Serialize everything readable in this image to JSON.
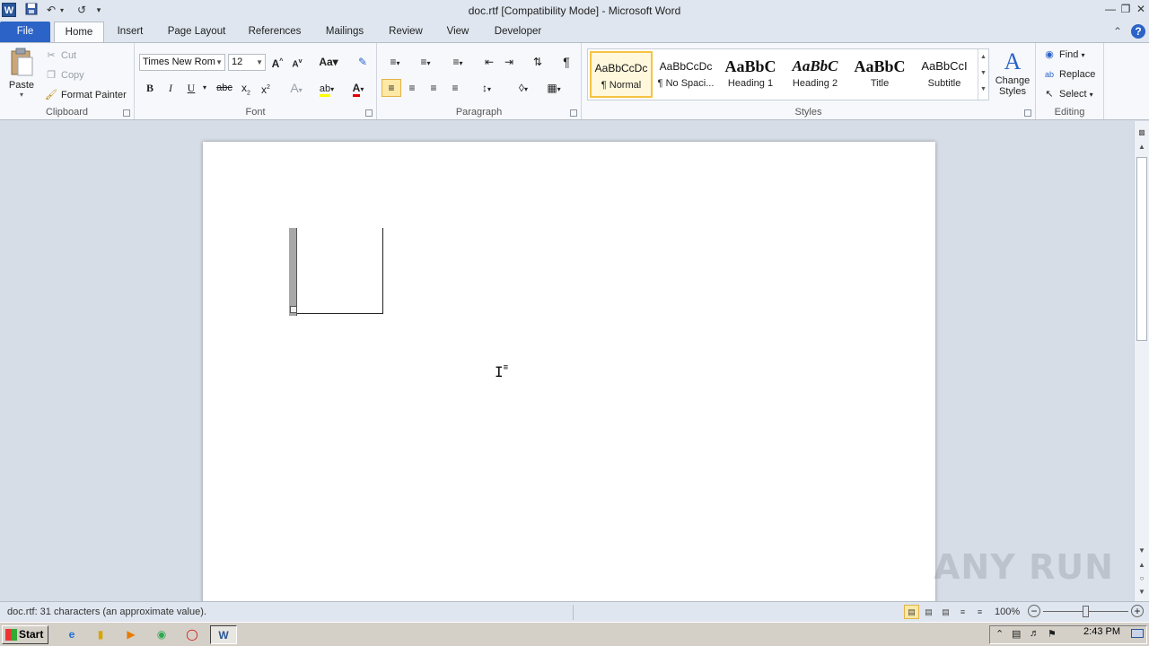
{
  "window": {
    "title": "doc.rtf [Compatibility Mode]  -  Microsoft Word",
    "app_letter": "W"
  },
  "tabs": [
    {
      "label": "File"
    },
    {
      "label": "Home"
    },
    {
      "label": "Insert"
    },
    {
      "label": "Page Layout"
    },
    {
      "label": "References"
    },
    {
      "label": "Mailings"
    },
    {
      "label": "Review"
    },
    {
      "label": "View"
    },
    {
      "label": "Developer"
    }
  ],
  "ribbon": {
    "clipboard": {
      "label": "Clipboard",
      "paste": "Paste",
      "cut": "Cut",
      "copy": "Copy",
      "format_painter": "Format Painter"
    },
    "font": {
      "label": "Font",
      "font_name": "Times New Rom",
      "font_size": "12"
    },
    "paragraph": {
      "label": "Paragraph"
    },
    "styles": {
      "label": "Styles",
      "items": [
        {
          "preview": "AaBbCcDc",
          "name": "¶ Normal"
        },
        {
          "preview": "AaBbCcDc",
          "name": "¶ No Spaci..."
        },
        {
          "preview": "AaBbC",
          "name": "Heading 1"
        },
        {
          "preview": "AaBbC",
          "name": "Heading 2"
        },
        {
          "preview": "AaBbC",
          "name": "Title"
        },
        {
          "preview": "AaBbCcI",
          "name": "Subtitle"
        }
      ],
      "change_styles": "Change Styles"
    },
    "editing": {
      "label": "Editing",
      "find": "Find",
      "replace": "Replace",
      "select": "Select"
    }
  },
  "status": {
    "text": "doc.rtf: 31 characters (an approximate value).",
    "zoom": "100%"
  },
  "taskbar": {
    "start": "Start",
    "clock": "2:43 PM"
  },
  "watermark": "ANY RUN",
  "colors": {
    "file_tab": "#2b63c7",
    "selected_highlight": "#fde9a5",
    "font_color_red": "#e00000",
    "highlight_yellow": "#ffff00"
  }
}
